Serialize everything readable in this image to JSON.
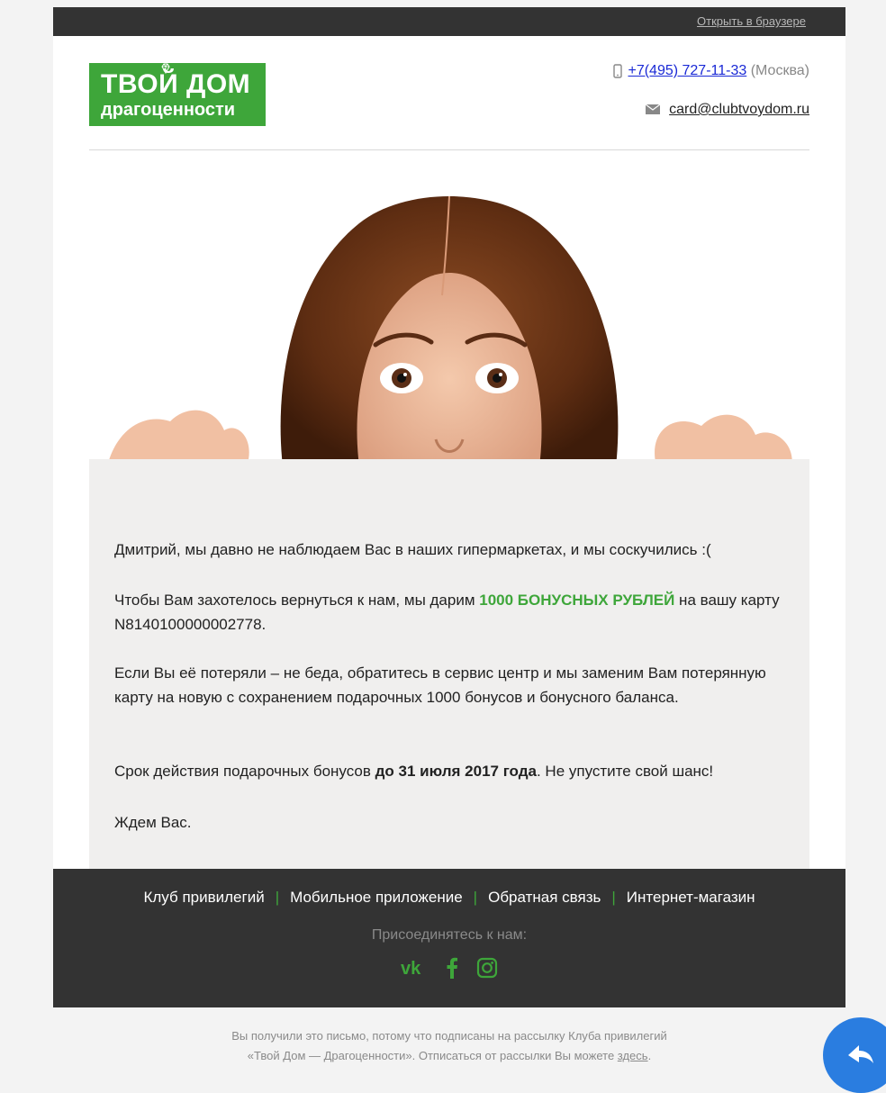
{
  "topbar": {
    "open_in_browser": "Открыть в браузере"
  },
  "header": {
    "logo_line1": "ТВОЙ ДОМ",
    "logo_line2": "драгоценности",
    "phone": "+7(495) 727-11-33",
    "phone_city": "(Москва)",
    "email": "card@clubtvoydom.ru"
  },
  "body": {
    "greeting": "Дмитрий, мы давно не наблюдаем Вас в наших гипермаркетах, и мы соскучились :(",
    "p2_before": "Чтобы Вам захотелось вернуться к нам, мы дарим ",
    "p2_bonus": "1000 БОНУСНЫХ РУБЛЕЙ",
    "p2_after": " на вашу карту N8140100000002778.",
    "p3": "Если Вы её потеряли – не беда, обратитесь в сервис центр и мы заменим Вам потерянную карту на новую с сохранением подарочных 1000 бонусов и бонусного баланса.",
    "p4_before": "Срок действия подарочных бонусов ",
    "p4_bold": "до 31 июля 2017 года",
    "p4_after": ". Не упустите свой шанс!",
    "p5": "Ждем Вас."
  },
  "footer": {
    "nav": [
      "Клуб привилегий",
      "Мобильное приложение",
      "Обратная связь",
      "Интернет-магазин"
    ],
    "join": "Присоединятесь к нам:",
    "social": [
      "vk-icon",
      "facebook-icon",
      "instagram-icon"
    ]
  },
  "legal": {
    "line1": "Вы получили это письмо, потому что подписаны на рассылку Клуба привилегий",
    "line2_before": "«Твой Дом — Драгоценности». Отписаться от рассылки Вы можете ",
    "link": "здесь",
    "line2_after": "."
  },
  "colors": {
    "brand_green": "#3ea63a",
    "dark": "#333333",
    "fab_blue": "#2a7de0"
  }
}
